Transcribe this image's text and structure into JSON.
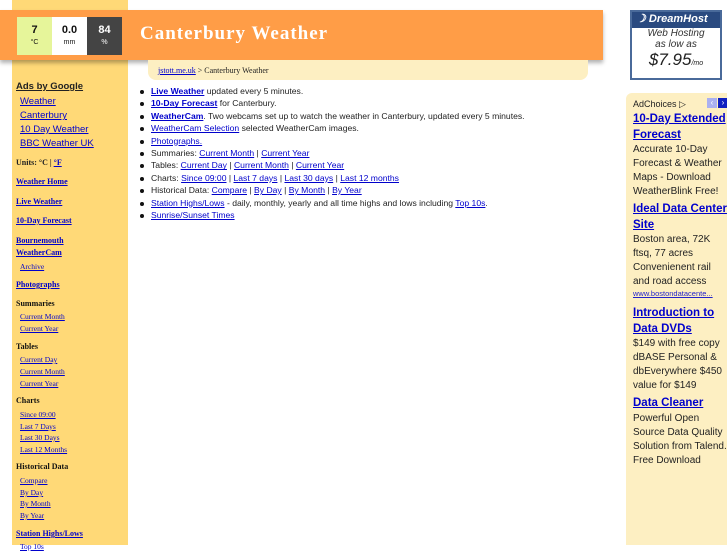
{
  "header": {
    "title": "Canterbury Weather",
    "temp": {
      "value": "7",
      "unit": "°C"
    },
    "rain": {
      "value": "0.0",
      "unit": "mm"
    },
    "humidity": {
      "value": "84",
      "unit": "%"
    }
  },
  "breadcrumb": {
    "home": "jstott.me.uk",
    "sep": " > ",
    "current": "Canterbury Weather"
  },
  "sidebar": {
    "ads_title": "Ads by Google",
    "ads": [
      "Weather",
      "Canterbury",
      "10 Day Weather",
      "BBC Weather UK"
    ],
    "units_label": "Units:",
    "units_c": "°C",
    "units_sep": " | ",
    "units_f": "°F",
    "weather_home": "Weather Home",
    "live_weather": "Live Weather",
    "forecast": "10-Day Forecast",
    "bournemouth": "Bournemouth",
    "weathercam": "WeatherCam",
    "archive": "Archive",
    "photographs": "Photographs",
    "summaries": "Summaries",
    "summaries_items": [
      "Current Month",
      "Current Year"
    ],
    "tables": "Tables",
    "tables_items": [
      "Current Day",
      "Current Month",
      "Current Year"
    ],
    "charts": "Charts",
    "charts_items": [
      "Since 09:00",
      "Last 7 Days",
      "Last 30 Days",
      "Last 12 Months"
    ],
    "historical": "Historical Data",
    "historical_items": [
      "Compare",
      "By Day",
      "By Month",
      "By Year"
    ],
    "highs_lows": "Station Highs/Lows",
    "top10": "Top 10s"
  },
  "main": {
    "live": "Live Weather",
    "live_text": " updated every 5 minutes.",
    "forecast": "10-Day Forecast",
    "forecast_text": " for Canterbury.",
    "cam": "WeatherCam",
    "cam_text": ". Two webcams set up to watch the weather in Canterbury, updated every 5 minutes.",
    "camsel": "WeatherCam Selection",
    "camsel_text": " selected WeatherCam images.",
    "photos": "Photographs.",
    "summaries_label": "Summaries: ",
    "summaries": [
      "Current Month",
      "Current Year"
    ],
    "tables_label": "Tables: ",
    "tables": [
      "Current Day",
      "Current Month",
      "Current Year"
    ],
    "charts_label": "Charts: ",
    "charts": [
      "Since 09:00",
      "Last 7 days",
      "Last 30 days",
      "Last 12 months"
    ],
    "hist_label": "Historical Data: ",
    "hist": [
      "Compare",
      "By Day",
      "By Month",
      "By Year"
    ],
    "highs": "Station Highs/Lows",
    "highs_text": " - daily, monthly, yearly and all time highs and lows including ",
    "top10": "Top 10s",
    "period": ".",
    "sun": "Sunrise/Sunset Times",
    "sep": " | "
  },
  "dreamhost": {
    "brand": "DreamHost",
    "line1": "Web Hosting",
    "line2": "as low as",
    "price": "$7.95",
    "per": "/mo"
  },
  "adchoices": {
    "label": "AdChoices",
    "ads": [
      {
        "title": "10-Day Extended Forecast",
        "text": "Accurate 10-Day Forecast & Weather Maps - Download WeatherBlink Free!"
      },
      {
        "title": "Ideal Data Center Site",
        "text": "Boston area, 72K ftsq, 77 acres Convenienent rail and road access",
        "url": "www.bostondatacente..."
      },
      {
        "title": "Introduction to Data DVDs",
        "text": "$149 with free copy dBASE Personal & dbEverywhere $450 value for $149"
      },
      {
        "title": "Data Cleaner",
        "text": "Powerful Open Source Data Quality Solution from Talend. Free Download"
      }
    ]
  },
  "colors": {
    "sidebar": "#FFD977",
    "header": "#FF9D47",
    "panel": "#FDEFC2",
    "link": "#0000CC"
  }
}
